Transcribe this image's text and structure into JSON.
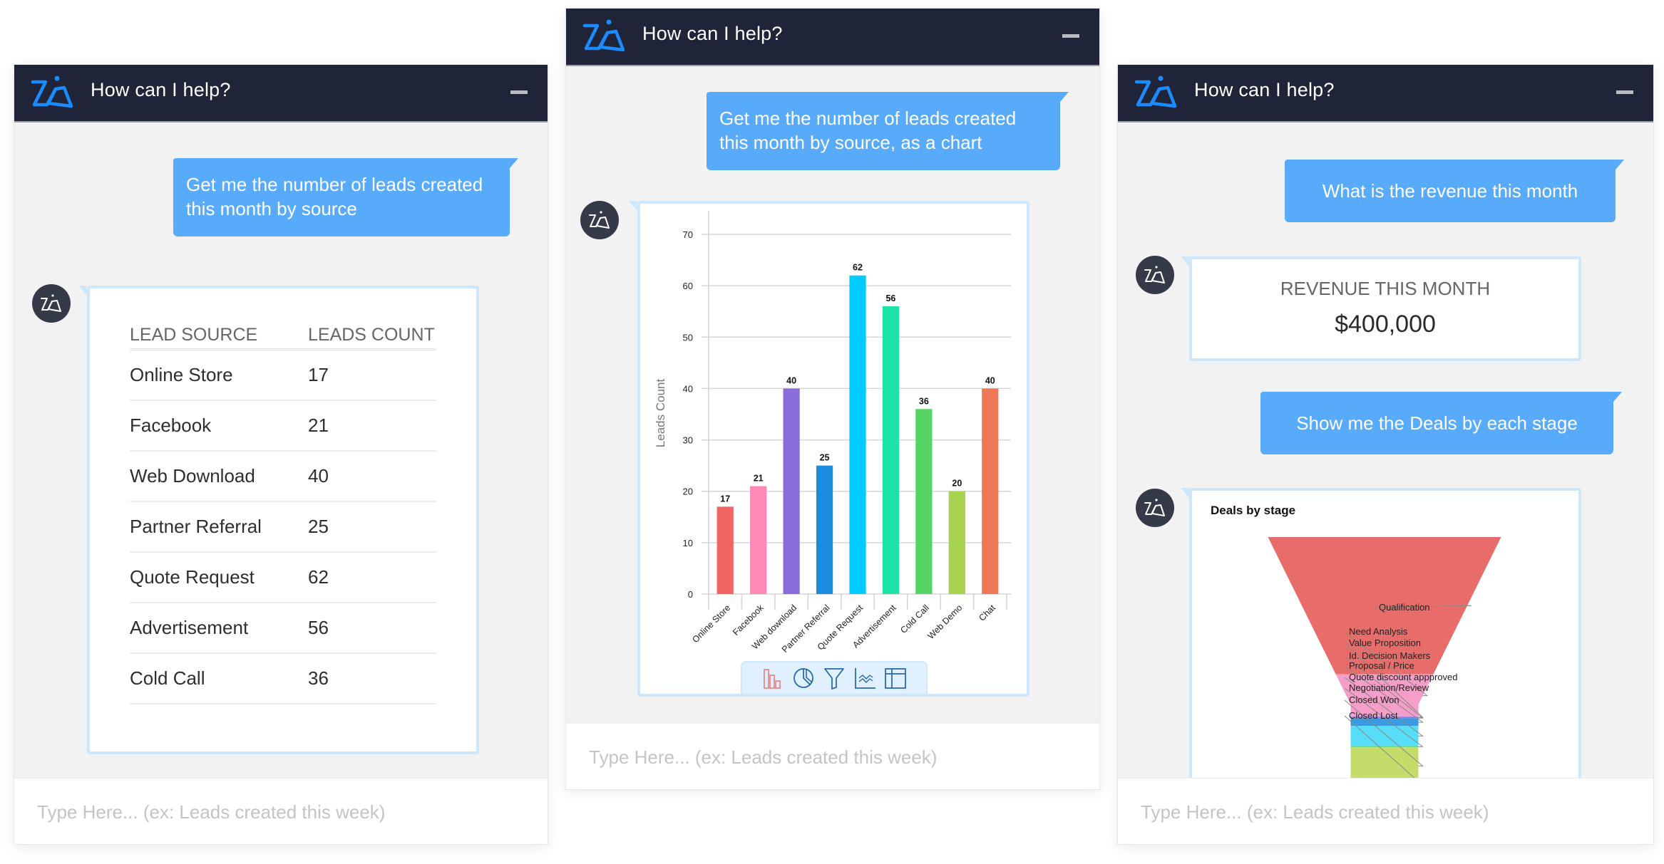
{
  "colors": {
    "header_bg": "#1f2438",
    "accent_blue": "#58abfb",
    "logo_blue": "#1a8cff",
    "card_border": "#cfe7fb",
    "panel_bg": "#f2f2f2"
  },
  "panels": [
    {
      "header": {
        "title": "How can I help?",
        "logo": "zia-logo-icon",
        "minimize": "minimize-icon"
      },
      "user_message": "Get me the number of leads created this month by source",
      "response_table": {
        "columns": [
          "LEAD SOURCE",
          "LEADS COUNT"
        ],
        "rows": [
          [
            "Online Store",
            "17"
          ],
          [
            "Facebook",
            "21"
          ],
          [
            "Web Download",
            "40"
          ],
          [
            "Partner Referral",
            "25"
          ],
          [
            "Quote Request",
            "62"
          ],
          [
            "Advertisement",
            "56"
          ],
          [
            "Cold Call",
            "36"
          ]
        ]
      },
      "input_placeholder": "Type Here... (ex: Leads created this week)"
    },
    {
      "header": {
        "title": "How can I help?",
        "logo": "zia-logo-icon",
        "minimize": "minimize-icon"
      },
      "user_message": "Get me the number of leads created this month by source, as a chart",
      "chart_toolbar": [
        "bar-chart-icon",
        "pie-chart-icon",
        "funnel-icon",
        "line-chart-icon",
        "table-icon"
      ],
      "input_placeholder": "Type Here... (ex: Leads created this week)"
    },
    {
      "header": {
        "title": "How can I help?",
        "logo": "zia-logo-icon",
        "minimize": "minimize-icon"
      },
      "user_message_1": "What is the revenue this month",
      "revenue": {
        "label": "REVENUE THIS MONTH",
        "value": "$400,000"
      },
      "user_message_2": "Show me the Deals by each stage",
      "input_placeholder": "Type Here... (ex: Leads created this week)"
    }
  ],
  "chart_data": [
    {
      "type": "bar",
      "title": "",
      "xlabel": "",
      "ylabel": "Leads Count",
      "categories": [
        "Online Store",
        "Facebook",
        "Web download",
        "Partner Referral",
        "Quote Request",
        "Advertisement",
        "Cold Call",
        "Web Demo",
        "Chat"
      ],
      "values": [
        17,
        21,
        40,
        25,
        62,
        56,
        36,
        20,
        40
      ],
      "colors": [
        "#f26565",
        "#ff88b4",
        "#8a6ddb",
        "#1b8bdc",
        "#00ccff",
        "#1ee3a7",
        "#55d464",
        "#a7d34e",
        "#ee7758"
      ],
      "ylim": [
        0,
        70
      ],
      "yticks": [
        0,
        10,
        20,
        30,
        40,
        50,
        60,
        70
      ],
      "grid": true,
      "data_labels": true
    },
    {
      "type": "funnel",
      "title": "Deals by stage",
      "stages": [
        "Qualification",
        "Need Analysis",
        "Value Proposition",
        "Id. Decision Makers",
        "Proposal / Price",
        "Quote discount appproved",
        "Negotiation/Review",
        "Closed Won",
        "Closed Lost"
      ],
      "relative_values": [
        0.55,
        0.17,
        0.0,
        0.0,
        0.03,
        0.08,
        0.005,
        0.15,
        0.005
      ],
      "colors": [
        "#e86d6a",
        "#f49ec9",
        "#7c6be0",
        "#5a87e8",
        "#3a9be3",
        "#58ddf8",
        "#7ccf6f",
        "#c4dd6a",
        "#f5a27a"
      ]
    }
  ]
}
